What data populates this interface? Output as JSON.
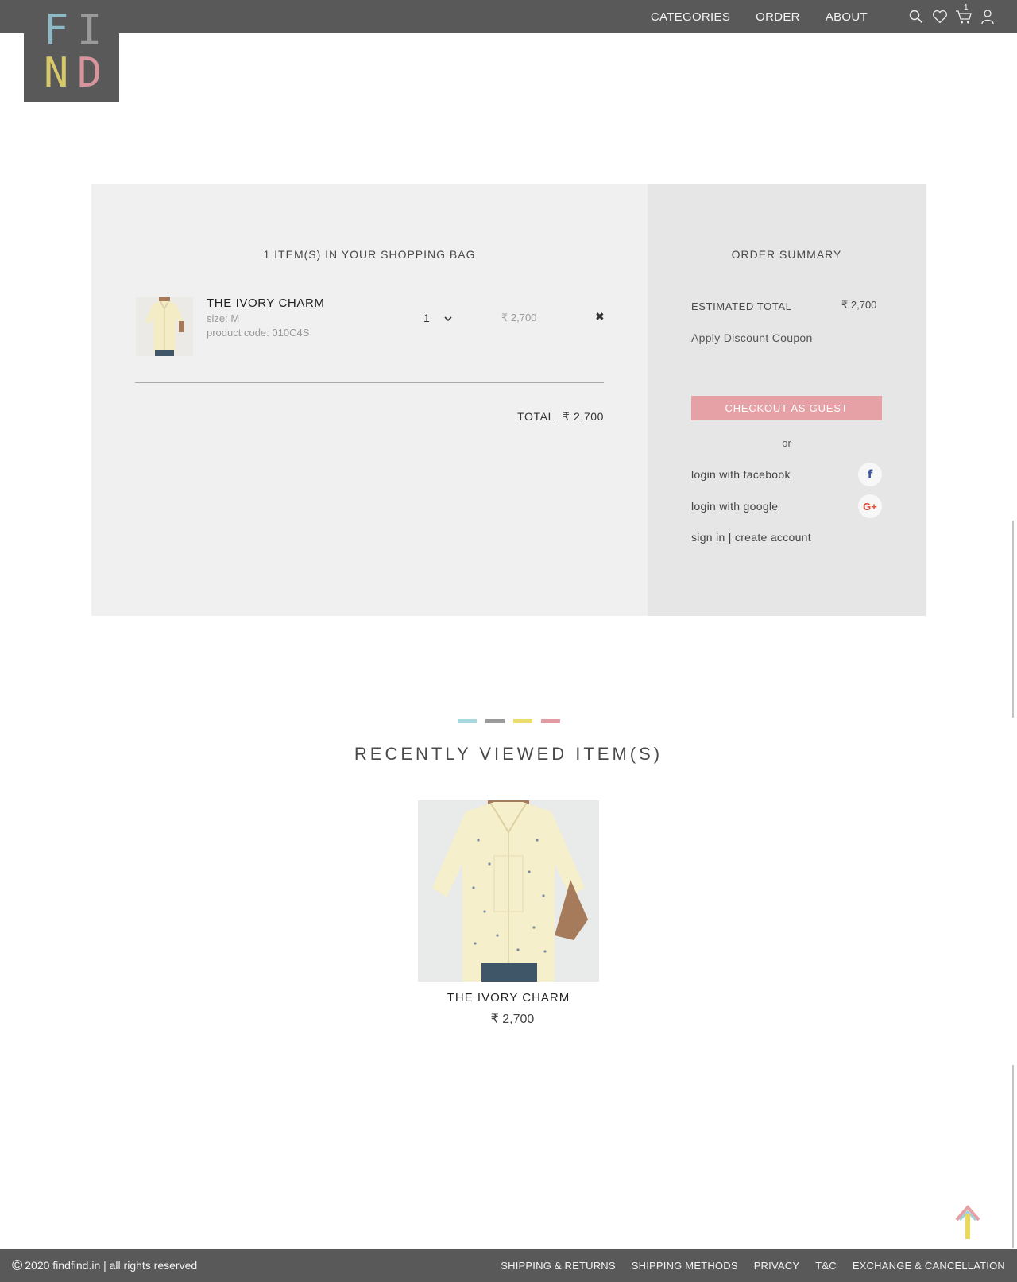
{
  "logo": {
    "letters": [
      "F",
      "I",
      "N",
      "D"
    ]
  },
  "nav": {
    "links": [
      "CATEGORIES",
      "ORDER",
      "ABOUT"
    ],
    "icons": [
      "search-icon",
      "heart-icon",
      "cart-icon",
      "user-icon"
    ],
    "cart_count": "1"
  },
  "bag": {
    "title": "1 ITEM(S) IN YOUR SHOPPING BAG",
    "item": {
      "name": "THE IVORY CHARM",
      "size": "size: M",
      "code": "product code: 010C4S",
      "qty": "1",
      "price": "₹ 2,700",
      "remove_icon": "✖"
    },
    "total_label": "TOTAL",
    "total_value": "₹ 2,700"
  },
  "summary": {
    "title": "ORDER SUMMARY",
    "estimated_label": "ESTIMATED TOTAL",
    "estimated_value": "₹  2,700",
    "coupon": "Apply Discount Coupon",
    "checkout": "CHECKOUT AS GUEST",
    "or": "or",
    "facebook": "login with facebook",
    "google": "login with google",
    "signin": "sign in",
    "separator": "|",
    "create": "create account"
  },
  "recent": {
    "title": "RECENTLY VIEWED ITEM(S)",
    "item_name": "THE IVORY CHARM",
    "item_price": "₹ 2,700",
    "dash_colors": [
      "#a6d8df",
      "#9a9a9a",
      "#ecdc6c",
      "#e29ba3"
    ]
  },
  "footer": {
    "copyright": "2020 findfind.in | all rights reserved",
    "links": [
      "SHIPPING & RETURNS",
      "SHIPPING METHODS",
      "PRIVACY",
      "T&C",
      "EXCHANGE & CANCELLATION"
    ]
  },
  "colors": {
    "bar": "#595959",
    "accent": "#e6a1a6",
    "panel": "#f0f0f0",
    "summary_panel": "#e6e6e6"
  }
}
